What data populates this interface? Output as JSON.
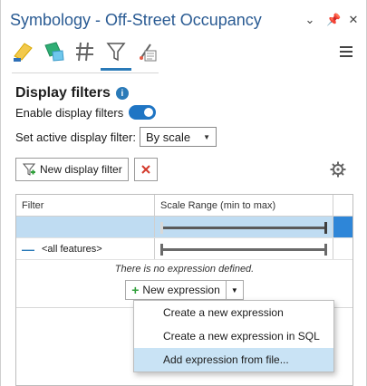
{
  "window": {
    "title": "Symbology - Off-Street Occupancy",
    "controls": [
      "chevron-down-icon",
      "pin-icon",
      "close-icon"
    ]
  },
  "tabs": [
    "primary-symbology-icon",
    "vary-symbology-icon",
    "symbol-layer-drawing-icon",
    "display-filters-icon",
    "label-classes-icon"
  ],
  "section": {
    "title": "Display filters"
  },
  "enable": {
    "label": "Enable display filters",
    "checked": true
  },
  "active_filter": {
    "label": "Set active display filter:",
    "value": "By scale"
  },
  "toolbar": {
    "new_filter_label": "New display filter"
  },
  "grid": {
    "columns": [
      "Filter",
      "Scale Range (min to max)"
    ],
    "rows": [
      {
        "name": "",
        "selected": true
      },
      {
        "name": "<all features>",
        "selected": false
      }
    ],
    "no_expression_text": "There is no expression defined.",
    "new_expression_label": "New expression"
  },
  "dropdown": {
    "items": [
      {
        "label": "Create a new expression",
        "highlighted": false
      },
      {
        "label": "Create a new expression in SQL",
        "highlighted": false
      },
      {
        "label": "Add expression from file...",
        "highlighted": true
      }
    ]
  },
  "colors": {
    "accent": "#1f75c4",
    "title": "#2a5b93",
    "selection": "#bfdcf2"
  }
}
